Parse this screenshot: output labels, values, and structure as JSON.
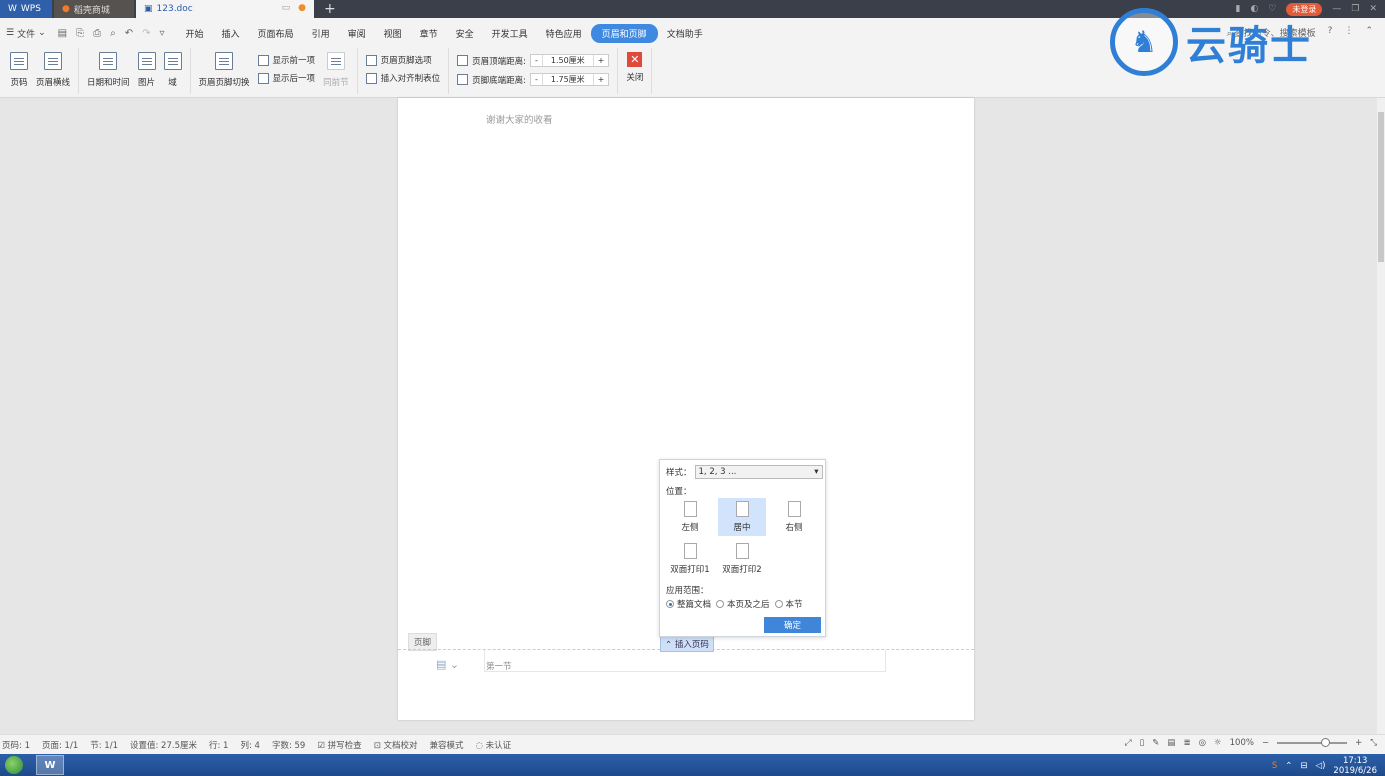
{
  "titlebar": {
    "tabs": [
      {
        "label": "WPS"
      },
      {
        "label": "稻壳商城"
      },
      {
        "label": "123.doc"
      }
    ],
    "login_badge": "未登录"
  },
  "menubar": {
    "file": "文件",
    "items": [
      "开始",
      "插入",
      "页面布局",
      "引用",
      "审阅",
      "视图",
      "章节",
      "安全",
      "开发工具",
      "特色应用",
      "页眉和页脚",
      "文档助手"
    ],
    "active": "页眉和页脚",
    "search_placeholder": "查找命令、搜索模板"
  },
  "ribbon": {
    "page_number": "页码",
    "header_line": "页眉横线",
    "date_time": "日期和时间",
    "picture": "图片",
    "field": "域",
    "switch": "页眉页脚切换",
    "show_prev": "显示前一项",
    "show_next": "显示后一项",
    "same_as_prev": "同前节",
    "options": "页眉页脚选项",
    "insert_align_tab": "插入对齐制表位",
    "header_top_label": "页眉顶端距离:",
    "header_top_value": "1.50厘米",
    "footer_bottom_label": "页脚底端距离:",
    "footer_bottom_value": "1.75厘米",
    "close": "关闭"
  },
  "logo": {
    "text": "云骑士"
  },
  "document": {
    "body_text": "谢谢大家的收看",
    "footer_label": "页脚",
    "section_label": "第一节",
    "insert_page_number": "插入页码"
  },
  "popup": {
    "style_label": "样式：",
    "style_value": "1, 2, 3 ...",
    "position_label": "位置：",
    "positions": [
      "左侧",
      "居中",
      "右侧",
      "双面打印1",
      "双面打印2"
    ],
    "selected_position": "居中",
    "range_label": "应用范围：",
    "ranges": [
      "整篇文档",
      "本页及之后",
      "本节"
    ],
    "selected_range": "整篇文档",
    "ok": "确定"
  },
  "statusbar": {
    "page": "页码: 1",
    "pages": "页面: 1/1",
    "section": "节: 1/1",
    "setting": "设置值: 27.5厘米",
    "row": "行: 1",
    "col": "列: 4",
    "words": "字数: 59",
    "spell": "拼写检查",
    "proof": "文档校对",
    "compat": "兼容模式",
    "cert": "未认证",
    "zoom": "100%"
  },
  "taskbar": {
    "time": "17:13",
    "date": "2019/6/26"
  },
  "colors": {
    "accent": "#3f86da",
    "close_red": "#e04a3b",
    "logo_blue": "#2f7fd6"
  }
}
